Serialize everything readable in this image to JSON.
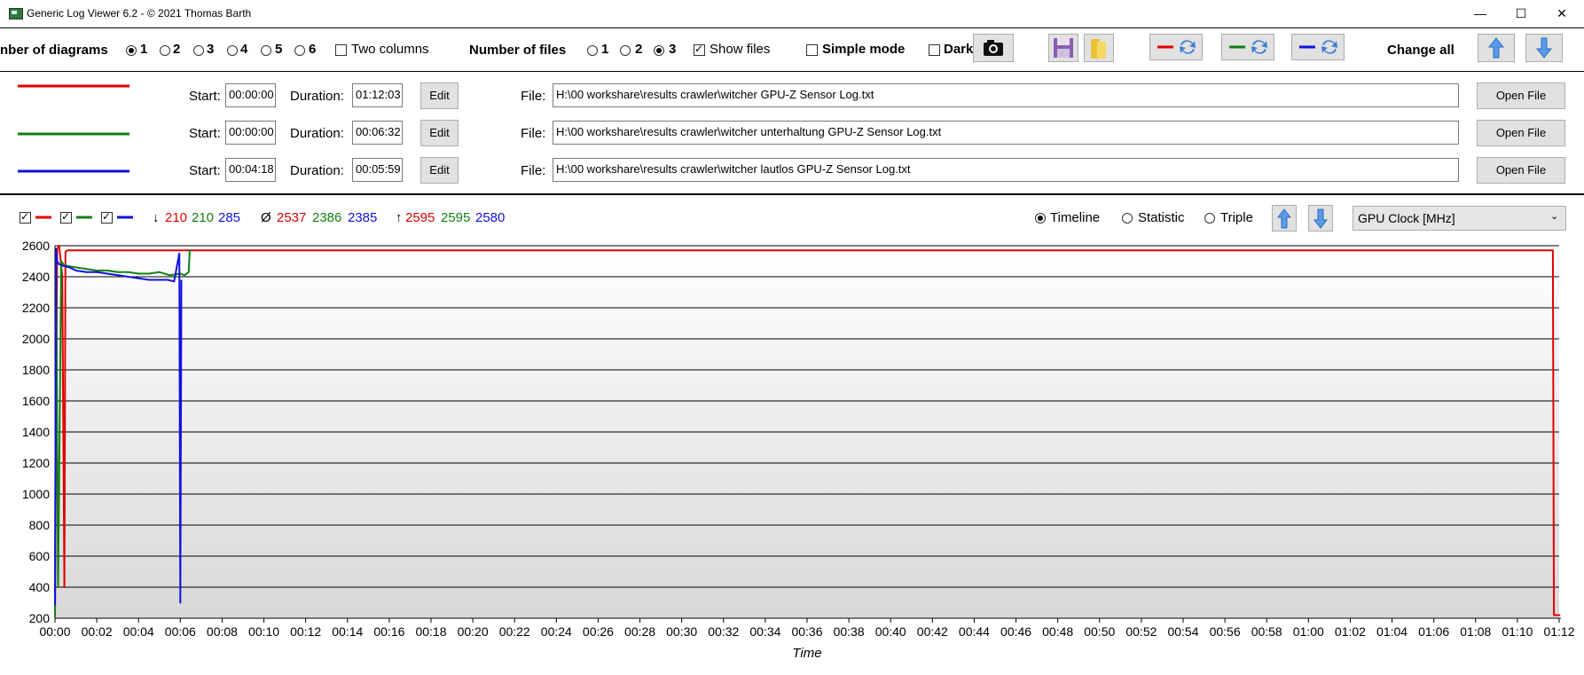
{
  "window": {
    "title": "Generic Log Viewer 6.2 - © 2021 Thomas Barth",
    "minimize": "—",
    "maximize": "☐",
    "close": "✕"
  },
  "toolbar": {
    "diagrams_label": "nber of diagrams",
    "diagram_options": [
      "1",
      "2",
      "3",
      "4",
      "5",
      "6"
    ],
    "selected_diagrams": "1",
    "two_columns_label": "Two columns",
    "two_columns_checked": false,
    "files_label": "Number of files",
    "file_options": [
      "1",
      "2",
      "3"
    ],
    "selected_files": "3",
    "show_files_label": "Show files",
    "show_files_checked": true,
    "simple_mode_label": "Simple mode",
    "dark_label": "Dark",
    "change_all_label": "Change all",
    "colors": {
      "red": "#e00000",
      "green": "#108010",
      "blue": "#1010e0",
      "accent": "#3a7bd5"
    }
  },
  "files": [
    {
      "color": "#e00000",
      "start_label": "Start:",
      "start": "00:00:00",
      "duration_label": "Duration:",
      "duration": "01:12:03",
      "edit": "Edit",
      "file_label": "File:",
      "path": "H:\\00 workshare\\results crawler\\witcher GPU-Z Sensor Log.txt",
      "open": "Open File"
    },
    {
      "color": "#108010",
      "start_label": "Start:",
      "start": "00:00:00",
      "duration_label": "Duration:",
      "duration": "00:06:32",
      "edit": "Edit",
      "file_label": "File:",
      "path": "H:\\00 workshare\\results crawler\\witcher unterhaltung GPU-Z Sensor Log.txt",
      "open": "Open File"
    },
    {
      "color": "#1010e0",
      "start_label": "Start:",
      "start": "00:04:18",
      "duration_label": "Duration:",
      "duration": "00:05:59",
      "edit": "Edit",
      "file_label": "File:",
      "path": "H:\\00 workshare\\results crawler\\witcher lautlos GPU-Z Sensor Log.txt",
      "open": "Open File"
    }
  ],
  "stats": {
    "min_symbol": "↓",
    "min": [
      "210",
      "210",
      "285"
    ],
    "avg_symbol": "Ø",
    "avg": [
      "2537",
      "2386",
      "2385"
    ],
    "max_symbol": "↑",
    "max": [
      "2595",
      "2595",
      "2580"
    ]
  },
  "view": {
    "modes": [
      "Timeline",
      "Statistic",
      "Triple"
    ],
    "selected_mode": "Timeline",
    "sensor": "GPU Clock [MHz]"
  },
  "chart_data": {
    "type": "line",
    "xlabel": "Time",
    "ylabel": "",
    "ylim": [
      200,
      2600
    ],
    "yticks": [
      "200",
      "400",
      "600",
      "800",
      "1000",
      "1200",
      "1400",
      "1600",
      "1800",
      "2000",
      "2200",
      "2400",
      "2600"
    ],
    "xlim_minutes": [
      0,
      72
    ],
    "xticks": [
      "00:00",
      "00:02",
      "00:04",
      "00:06",
      "00:08",
      "00:10",
      "00:12",
      "00:14",
      "00:16",
      "00:18",
      "00:20",
      "00:22",
      "00:24",
      "00:26",
      "00:28",
      "00:30",
      "00:32",
      "00:34",
      "00:36",
      "00:38",
      "00:40",
      "00:42",
      "00:44",
      "00:46",
      "00:48",
      "00:50",
      "00:52",
      "00:54",
      "00:56",
      "00:58",
      "01:00",
      "01:02",
      "01:04",
      "01:06",
      "01:08",
      "01:10",
      "01:12"
    ],
    "grid": true,
    "series": [
      {
        "color": "#e00000",
        "x_minutes": [
          0,
          0.1,
          0.2,
          0.35,
          0.45,
          0.5,
          0.6,
          71.6,
          71.7,
          71.75,
          72.05
        ],
        "y": [
          210,
          2580,
          2600,
          2400,
          400,
          2560,
          2570,
          2570,
          2570,
          220,
          220
        ]
      },
      {
        "color": "#108010",
        "x_minutes": [
          0,
          0.05,
          0.15,
          0.3,
          0.4,
          0.6,
          1.0,
          1.5,
          2.0,
          2.5,
          3.0,
          3.5,
          4.0,
          4.5,
          5.0,
          5.5,
          6.0,
          6.2,
          6.4,
          6.45,
          6.53
        ],
        "y": [
          210,
          2550,
          400,
          2500,
          2480,
          2470,
          2460,
          2450,
          2440,
          2440,
          2430,
          2430,
          2420,
          2420,
          2430,
          2410,
          2420,
          2410,
          2430,
          2570,
          2570
        ]
      },
      {
        "color": "#1010e0",
        "x_minutes": [
          0,
          0.05,
          0.1,
          0.2,
          0.4,
          0.7,
          1.0,
          1.5,
          2.0,
          2.5,
          3.0,
          3.5,
          4.0,
          4.5,
          5.0,
          5.4,
          5.7,
          5.95,
          6.0,
          6.05
        ],
        "y": [
          285,
          2580,
          2500,
          2480,
          2470,
          2460,
          2440,
          2430,
          2430,
          2420,
          2410,
          2400,
          2390,
          2380,
          2380,
          2380,
          2370,
          2550,
          300,
          2380
        ]
      }
    ]
  }
}
